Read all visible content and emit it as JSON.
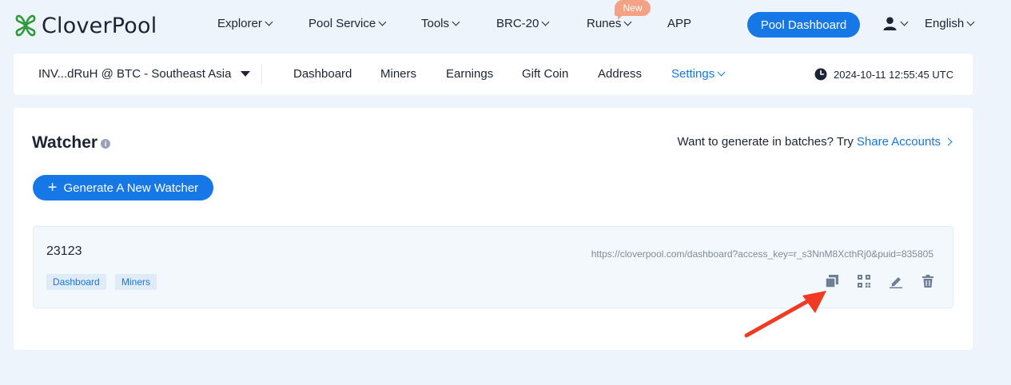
{
  "brand": {
    "name": "CloverPool"
  },
  "topnav": {
    "items": [
      {
        "label": "Explorer",
        "dropdown": true
      },
      {
        "label": "Pool Service",
        "dropdown": true
      },
      {
        "label": "Tools",
        "dropdown": true
      },
      {
        "label": "BRC-20",
        "dropdown": true
      },
      {
        "label": "Runes",
        "dropdown": true,
        "badge": "New"
      },
      {
        "label": "APP",
        "dropdown": false
      }
    ],
    "dashboard_button": "Pool Dashboard",
    "user_icon": "user-icon",
    "language": "English"
  },
  "subnav": {
    "account": "INV...dRuH @ BTC - Southeast Asia",
    "tabs": [
      {
        "label": "Dashboard",
        "active": false
      },
      {
        "label": "Miners",
        "active": false
      },
      {
        "label": "Earnings",
        "active": false
      },
      {
        "label": "Gift Coin",
        "active": false
      },
      {
        "label": "Address",
        "active": false
      },
      {
        "label": "Settings",
        "active": true
      }
    ],
    "time": "2024-10-11 12:55:45 UTC"
  },
  "main": {
    "title": "Watcher",
    "batch_text": "Want to generate in batches? Try",
    "batch_link": "Share Accounts",
    "generate_button": "Generate A New Watcher",
    "watcher": {
      "name": "23123",
      "url": "https://cloverpool.com/dashboard?access_key=r_s3NnM8XcthRj0&puid=835805",
      "tags": [
        "Dashboard",
        "Miners"
      ],
      "actions": [
        "copy-icon",
        "qrcode-icon",
        "edit-icon",
        "delete-icon"
      ]
    }
  },
  "colors": {
    "accent": "#1677e6",
    "badge": "#f5a183",
    "annotation_arrow": "#f03a22",
    "background": "#eef4fb"
  }
}
